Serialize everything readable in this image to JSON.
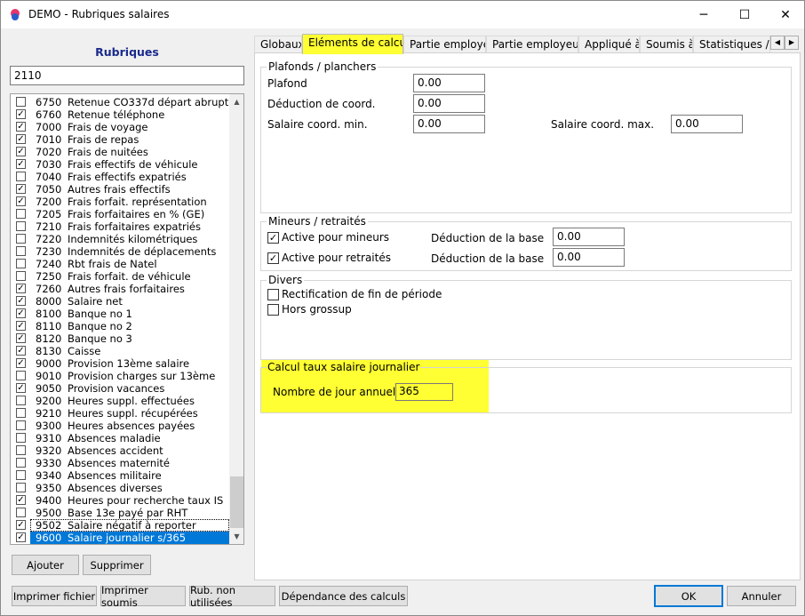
{
  "window": {
    "title": "DEMO - Rubriques salaires",
    "minimize": "─",
    "maximize": "☐",
    "close": "✕"
  },
  "left": {
    "title": "Rubriques",
    "search_value": "2110",
    "items": [
      {
        "code": "6750",
        "label": "Retenue CO337d départ abrupt",
        "checked": false
      },
      {
        "code": "6760",
        "label": "Retenue téléphone",
        "checked": true
      },
      {
        "code": "7000",
        "label": "Frais de voyage",
        "checked": true
      },
      {
        "code": "7010",
        "label": "Frais de repas",
        "checked": true
      },
      {
        "code": "7020",
        "label": "Frais de nuitées",
        "checked": true
      },
      {
        "code": "7030",
        "label": "Frais effectifs de véhicule",
        "checked": true
      },
      {
        "code": "7040",
        "label": "Frais effectifs expatriés",
        "checked": false
      },
      {
        "code": "7050",
        "label": "Autres frais effectifs",
        "checked": true
      },
      {
        "code": "7200",
        "label": "Frais forfait. représentation",
        "checked": true
      },
      {
        "code": "7205",
        "label": "Frais forfaitaires en % (GE)",
        "checked": false
      },
      {
        "code": "7210",
        "label": "Frais forfaitaires expatriés",
        "checked": false
      },
      {
        "code": "7220",
        "label": "Indemnités kilométriques",
        "checked": false
      },
      {
        "code": "7230",
        "label": "Indemnités de déplacements",
        "checked": false
      },
      {
        "code": "7240",
        "label": "Rbt frais de Natel",
        "checked": false
      },
      {
        "code": "7250",
        "label": "Frais forfait. de véhicule",
        "checked": false
      },
      {
        "code": "7260",
        "label": "Autres frais forfaitaires",
        "checked": true
      },
      {
        "code": "8000",
        "label": "Salaire net",
        "checked": true
      },
      {
        "code": "8100",
        "label": "Banque no 1",
        "checked": true
      },
      {
        "code": "8110",
        "label": "Banque no 2",
        "checked": true
      },
      {
        "code": "8120",
        "label": "Banque no 3",
        "checked": true
      },
      {
        "code": "8130",
        "label": "Caisse",
        "checked": true
      },
      {
        "code": "9000",
        "label": "Provision 13ème salaire",
        "checked": true
      },
      {
        "code": "9010",
        "label": "Provision charges sur 13ème",
        "checked": false
      },
      {
        "code": "9050",
        "label": "Provision vacances",
        "checked": true
      },
      {
        "code": "9200",
        "label": "Heures suppl. effectuées",
        "checked": false
      },
      {
        "code": "9210",
        "label": "Heures suppl. récupérées",
        "checked": false
      },
      {
        "code": "9300",
        "label": "Heures absences payées",
        "checked": false
      },
      {
        "code": "9310",
        "label": "Absences maladie",
        "checked": false
      },
      {
        "code": "9320",
        "label": "Absences accident",
        "checked": false
      },
      {
        "code": "9330",
        "label": "Absences maternité",
        "checked": false
      },
      {
        "code": "9340",
        "label": "Absences militaire",
        "checked": false
      },
      {
        "code": "9350",
        "label": "Absences diverses",
        "checked": false
      },
      {
        "code": "9400",
        "label": "Heures pour recherche taux IS",
        "checked": true
      },
      {
        "code": "9500",
        "label": "Base 13e payé par RHT",
        "checked": false
      },
      {
        "code": "9502",
        "label": "Salaire négatif à reporter",
        "checked": true
      },
      {
        "code": "9600",
        "label": "Salaire journalier s/365",
        "checked": true
      }
    ],
    "add_button": "Ajouter",
    "delete_button": "Supprimer"
  },
  "tabs": [
    "Globaux",
    "Eléments de calcul",
    "Partie employé",
    "Partie employeur",
    "Appliqué à",
    "Soumis à",
    "Statistiques / C"
  ],
  "active_tab": "Eléments de calcul",
  "plafonds": {
    "title": "Plafonds / planchers",
    "plafond_label": "Plafond",
    "plafond_value": "0.00",
    "deduction_label": "Déduction de coord.",
    "deduction_value": "0.00",
    "sal_min_label": "Salaire coord. min.",
    "sal_min_value": "0.00",
    "sal_max_label": "Salaire coord. max.",
    "sal_max_value": "0.00"
  },
  "mineurs": {
    "title": "Mineurs / retraités",
    "mineurs_label": "Active pour mineurs",
    "mineurs_checked": true,
    "retraites_label": "Active pour retraités",
    "retraites_checked": true,
    "ded1_label": "Déduction de la base",
    "ded1_value": "0.00",
    "ded2_label": "Déduction de la base",
    "ded2_value": "0.00"
  },
  "divers": {
    "title": "Divers",
    "rectif_label": "Rectification de fin de période",
    "grossup_label": "Hors grossup"
  },
  "taux": {
    "title": "Calcul taux salaire journalier",
    "jours_label": "Nombre de jour annuel",
    "jours_value": "365"
  },
  "footer": {
    "print_file": "Imprimer fichier",
    "print_soumis": "Imprimer soumis",
    "unused": "Rub. non utilisées",
    "dependance": "Dépendance des calculs",
    "ok": "OK",
    "cancel": "Annuler"
  },
  "colors": {
    "highlight": "#ffff33",
    "selection": "#0078d7",
    "title_blue": "#1a2a8c"
  }
}
